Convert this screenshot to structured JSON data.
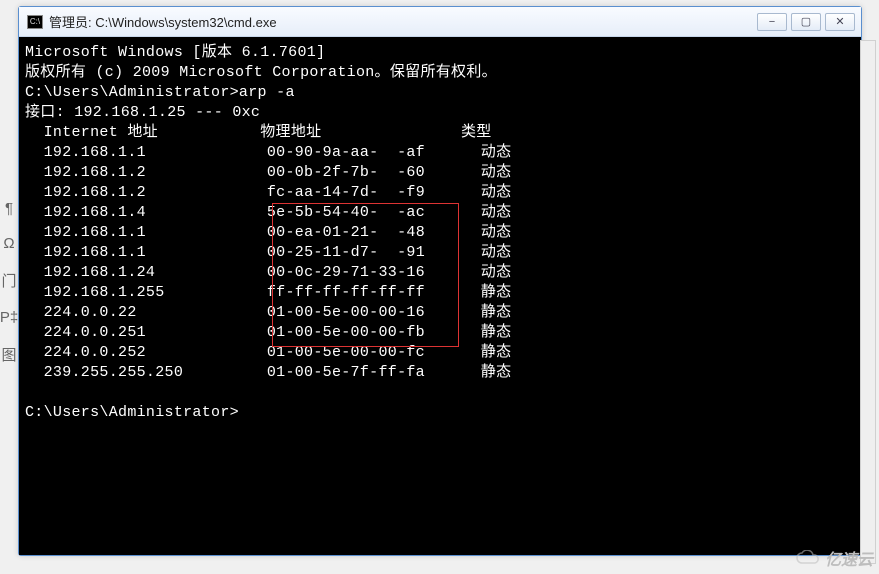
{
  "window": {
    "title": "管理员: C:\\Windows\\system32\\cmd.exe",
    "icon_label": "C:\\"
  },
  "controls": {
    "minimize": "−",
    "maximize": "▢",
    "close": "✕"
  },
  "sidebar_icons": [
    "¶",
    "Ω",
    "门",
    "P‡",
    "图"
  ],
  "lines": {
    "l0": "Microsoft Windows [版本 6.1.7601]",
    "l1": "版权所有 (c) 2009 Microsoft Corporation。保留所有权利。",
    "l2": "",
    "l3": "C:\\Users\\Administrator>arp -a",
    "l4": "",
    "l5": "接口: 192.168.1.25 --- 0xc",
    "hdr_ip": "  Internet 地址",
    "hdr_mac": "物理地址",
    "hdr_type": "类型"
  },
  "arp_rows": [
    {
      "ip": "192.168.1.1",
      "ip_mask": "",
      "mac_a": "00-90-9a-aa-",
      "mac_mask": "  ",
      "mac_b": "-af",
      "type": "动态"
    },
    {
      "ip": "192.168.1.2",
      "ip_mask": "",
      "mac_a": "00-0b-2f-7b-",
      "mac_mask": "  ",
      "mac_b": "-60",
      "type": "动态"
    },
    {
      "ip": "192.168.1.2",
      "ip_mask": " ",
      "mac_a": "fc-aa-14-7d-",
      "mac_mask": "  ",
      "mac_b": "-f9",
      "type": "动态"
    },
    {
      "ip": "192.168.1.4",
      "ip_mask": " ",
      "mac_a": "5e-5b-54-40-",
      "mac_mask": "  ",
      "mac_b": "-ac",
      "type": "动态"
    },
    {
      "ip": "192.168.1.1",
      "ip_mask": "  ",
      "mac_a": "00-ea-01-21-",
      "mac_mask": "  ",
      "mac_b": "-48",
      "type": "动态"
    },
    {
      "ip": "192.168.1.1",
      "ip_mask": "  ",
      "mac_a": "00-25-11-d7-",
      "mac_mask": "  ",
      "mac_b": "-91",
      "type": "动态"
    },
    {
      "ip": "192.168.1.24",
      "ip_mask": "  ",
      "mac_a": "00-0c-29-71-33-16",
      "mac_mask": "",
      "mac_b": "",
      "type": "动态"
    },
    {
      "ip": "192.168.1.255",
      "ip_mask": "",
      "mac_a": "ff-ff-ff-ff-ff-ff",
      "mac_mask": "",
      "mac_b": "",
      "type": "静态"
    },
    {
      "ip": "224.0.0.22",
      "ip_mask": "",
      "mac_a": "01-00-5e-00-00-16",
      "mac_mask": "",
      "mac_b": "",
      "type": "静态"
    },
    {
      "ip": "224.0.0.251",
      "ip_mask": "",
      "mac_a": "01-00-5e-00-00-fb",
      "mac_mask": "",
      "mac_b": "",
      "type": "静态"
    },
    {
      "ip": "224.0.0.252",
      "ip_mask": "",
      "mac_a": "01-00-5e-00-00-fc",
      "mac_mask": "",
      "mac_b": "",
      "type": "静态"
    },
    {
      "ip": "239.255.255.250",
      "ip_mask": "",
      "mac_a": "01-00-5e-7f-ff-fa",
      "mac_mask": "",
      "mac_b": "",
      "type": "静态"
    }
  ],
  "prompt_end": "C:\\Users\\Administrator>",
  "watermark": "亿速云"
}
